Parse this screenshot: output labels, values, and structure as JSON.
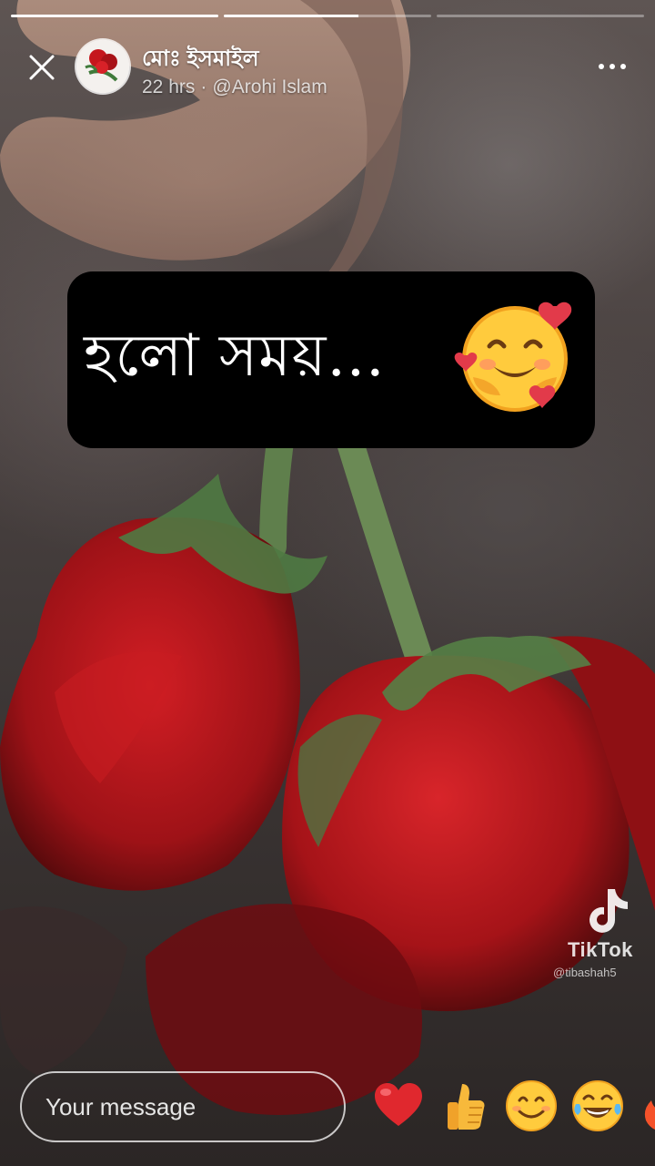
{
  "story": {
    "progress": [
      1.0,
      0.65,
      0.0
    ],
    "author_name": "মোঃ ইসমাইল",
    "time_ago": "22 hrs",
    "separator": "·",
    "mention": "@Arohi Islam"
  },
  "caption": {
    "text": "হলো সময়..."
  },
  "watermark": {
    "brand": "TikTok",
    "handle": "@tibashah5"
  },
  "composer": {
    "placeholder": "Your message"
  },
  "reactions": [
    "heart-icon",
    "thumbs-up-icon",
    "smiling-face-icon",
    "tears-of-joy-icon",
    "fire-icon"
  ],
  "colors": {
    "accent_heart": "#e0282e",
    "emoji_yellow": "#ffcb3d",
    "rose_red": "#b3141c",
    "leaf_green": "#4f7a42"
  }
}
